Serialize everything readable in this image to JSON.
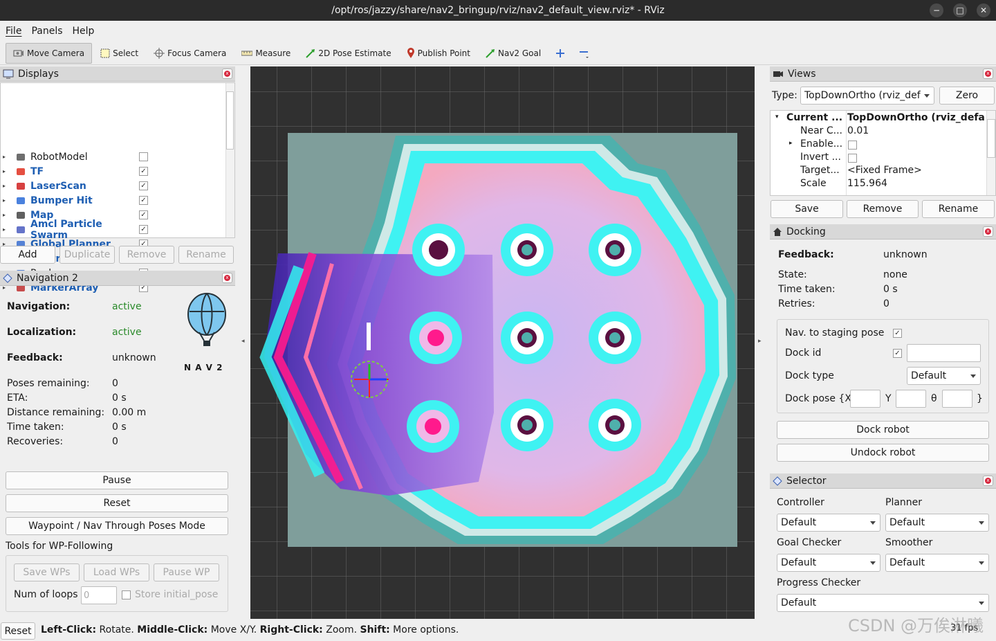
{
  "window": {
    "title": "/opt/ros/jazzy/share/nav2_bringup/rviz/nav2_default_view.rviz* - RViz",
    "min": "−",
    "max": "□",
    "close": "✕"
  },
  "menu": [
    "File",
    "Panels",
    "Help"
  ],
  "toolbar": {
    "move_camera": "Move Camera",
    "select": "Select",
    "focus_camera": "Focus Camera",
    "measure": "Measure",
    "pose_estimate": "2D Pose Estimate",
    "publish_point": "Publish Point",
    "nav2_goal": "Nav2 Goal"
  },
  "displays": {
    "title": "Displays",
    "items": [
      {
        "label": "RobotModel",
        "checked": false,
        "bold": false
      },
      {
        "label": "TF",
        "checked": true,
        "bold": true
      },
      {
        "label": "LaserScan",
        "checked": true,
        "bold": true
      },
      {
        "label": "Bumper Hit",
        "checked": true,
        "bold": true
      },
      {
        "label": "Map",
        "checked": true,
        "bold": true
      },
      {
        "label": "Amcl Particle Swarm",
        "checked": true,
        "bold": true
      },
      {
        "label": "Global Planner",
        "checked": true,
        "bold": true
      },
      {
        "label": "Controller",
        "checked": true,
        "bold": true
      },
      {
        "label": "Realsense",
        "checked": false,
        "bold": false
      },
      {
        "label": "MarkerArray",
        "checked": true,
        "bold": true
      }
    ],
    "buttons": {
      "add": "Add",
      "duplicate": "Duplicate",
      "remove": "Remove",
      "rename": "Rename"
    }
  },
  "navigation": {
    "title": "Navigation 2",
    "nav_label": "Navigation:",
    "nav_value": "active",
    "loc_label": "Localization:",
    "loc_value": "active",
    "feedback_label": "Feedback:",
    "feedback_value": "unknown",
    "logo_text": "N A V 2",
    "stats": [
      {
        "k": "Poses remaining:",
        "v": "0"
      },
      {
        "k": "ETA:",
        "v": "0 s"
      },
      {
        "k": "Distance remaining:",
        "v": "0.00 m"
      },
      {
        "k": "Time taken:",
        "v": "0 s"
      },
      {
        "k": "Recoveries:",
        "v": "0"
      }
    ],
    "pause": "Pause",
    "reset": "Reset",
    "waypoint_mode": "Waypoint / Nav Through Poses Mode",
    "wp_title": "Tools for WP-Following",
    "save_wps": "Save WPs",
    "load_wps": "Load WPs",
    "pause_wp": "Pause WP",
    "loops_label": "Num of loops",
    "loops_value": "0",
    "store_pose": "Store initial_pose"
  },
  "views": {
    "title": "Views",
    "type_label": "Type:",
    "type_value": "TopDownOrtho (rviz_def",
    "zero": "Zero",
    "props": [
      {
        "k": "Current ...",
        "v": "TopDownOrtho (rviz_defaul...",
        "bold": true
      },
      {
        "k": "Near C...",
        "v": "0.01"
      },
      {
        "k": "Enable...",
        "v": ""
      },
      {
        "k": "Invert ...",
        "v": ""
      },
      {
        "k": "Target...",
        "v": "<Fixed Frame>"
      },
      {
        "k": "Scale",
        "v": "115.964"
      }
    ],
    "save": "Save",
    "remove": "Remove",
    "rename": "Rename"
  },
  "docking": {
    "title": "Docking",
    "feedback_label": "Feedback:",
    "feedback_value": "unknown",
    "state_label": "State:",
    "state_value": "none",
    "time_label": "Time taken:",
    "time_value": "0 s",
    "retries_label": "Retries:",
    "retries_value": "0",
    "staging_label": "Nav. to staging pose",
    "dock_id_label": "Dock id",
    "dock_type_label": "Dock type",
    "dock_type_value": "Default",
    "dock_pose_label": "Dock pose {X",
    "y_label": "Y",
    "theta_label": "θ",
    "close_brace": "}",
    "dock_robot": "Dock robot",
    "undock_robot": "Undock robot"
  },
  "selector": {
    "title": "Selector",
    "controller_label": "Controller",
    "controller_value": "Default",
    "planner_label": "Planner",
    "planner_value": "Default",
    "goal_checker_label": "Goal Checker",
    "goal_checker_value": "Default",
    "smoother_label": "Smoother",
    "smoother_value": "Default",
    "progress_label": "Progress Checker",
    "progress_value": "Default"
  },
  "status": {
    "reset": "Reset",
    "left_click": "Left-Click:",
    "left_desc": " Rotate. ",
    "middle_click": "Middle-Click:",
    "middle_desc": " Move X/Y. ",
    "right_click": "Right-Click:",
    "right_desc": " Zoom. ",
    "shift": "Shift:",
    "shift_desc": " More options.",
    "fps": "31 fps",
    "watermark": "CSDN @万俟淋曦"
  }
}
